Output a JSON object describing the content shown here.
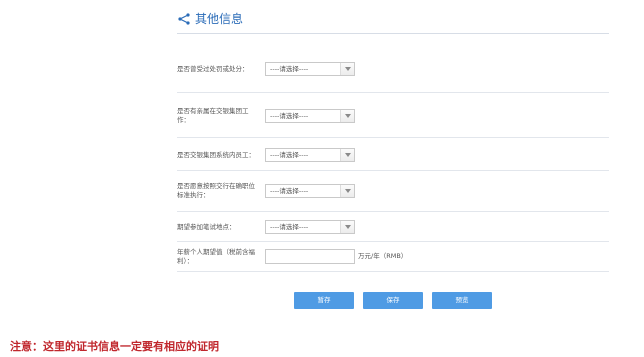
{
  "header": {
    "title": "其他信息",
    "icon": "share-icon"
  },
  "fields": [
    {
      "label": "是否曾受过处罚或处分：",
      "select_value": "----请选择----"
    },
    {
      "label": "是否有亲属在交银集团工作：",
      "select_value": "----请选择----"
    },
    {
      "label": "是否交银集团系统内员工：",
      "select_value": "----请选择----"
    },
    {
      "label": "是否愿意按照交行在确职位标准执行：",
      "select_value": "----请选择----"
    },
    {
      "label": "期望参加笔试地点：",
      "select_value": "----请选择----"
    }
  ],
  "salary": {
    "label": "年薪个人期望值（税前含福利）：",
    "value": "",
    "unit": "万元/年（RMB）"
  },
  "buttons": {
    "draft": "暂存",
    "save": "保存",
    "preview": "预览"
  },
  "note": "注意：这里的证书信息一定要有相应的证明",
  "colors": {
    "accent": "#2b6cb8",
    "button": "#4f9be4",
    "note": "#c0272d"
  }
}
